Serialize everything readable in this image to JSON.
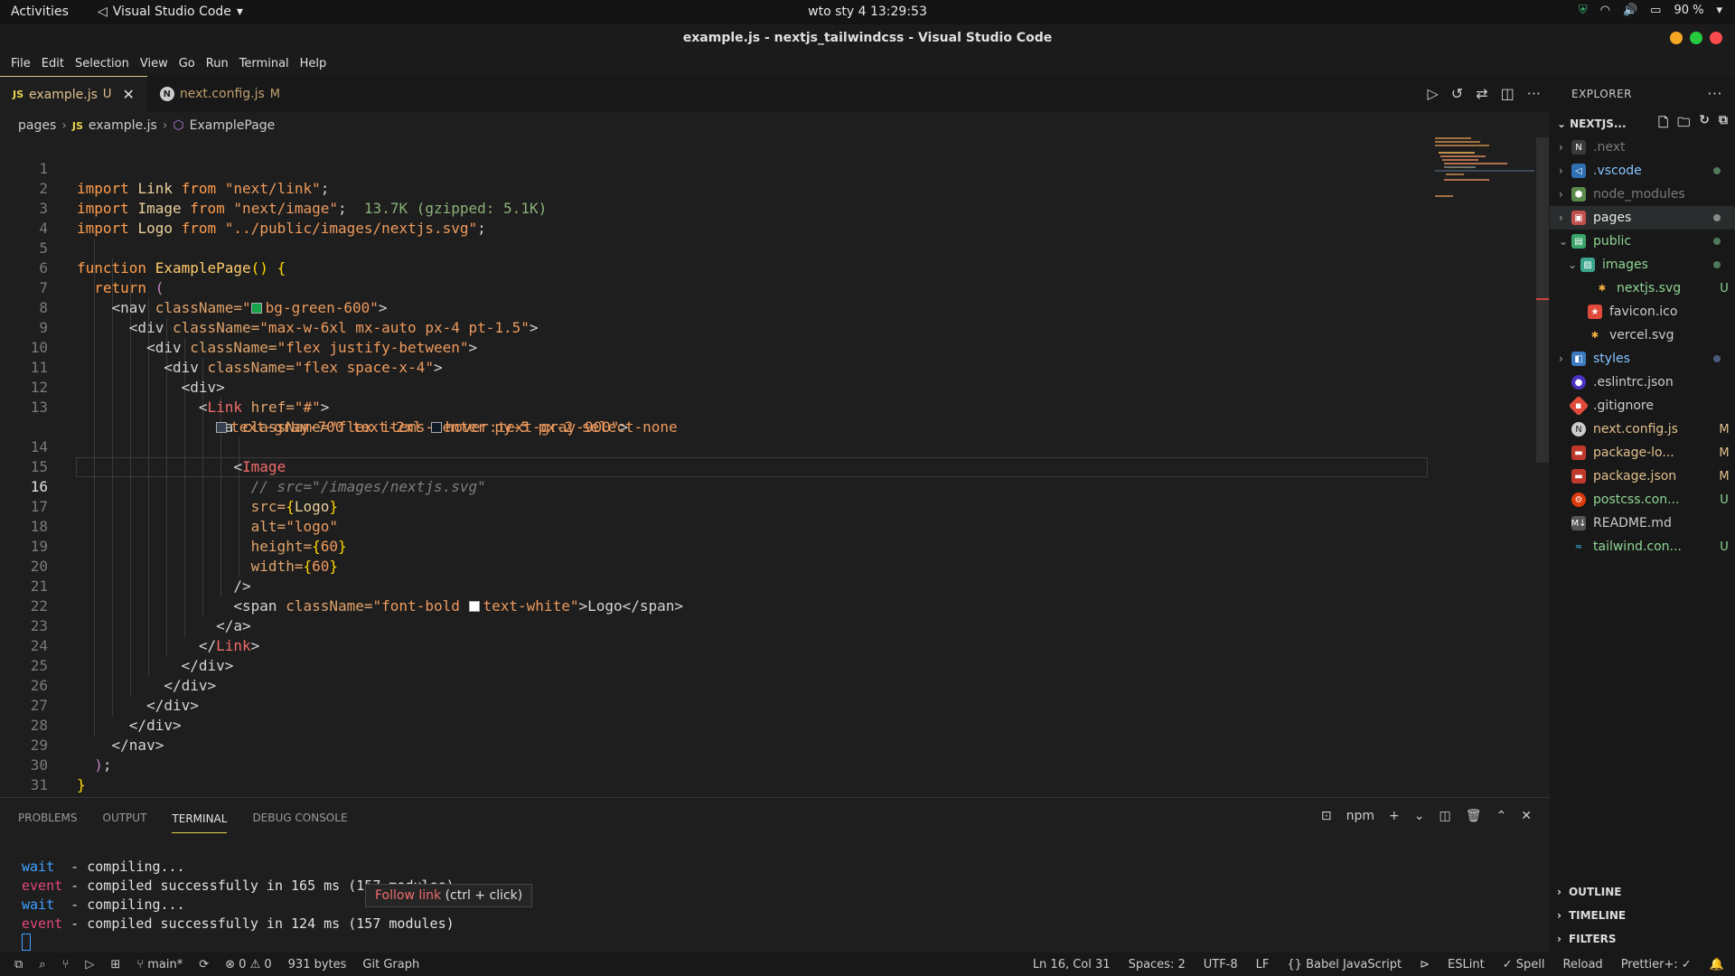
{
  "system": {
    "activities": "Activities",
    "app_name": "Visual Studio Code",
    "clock": "wto sty 4  13:29:53",
    "battery": "90 %"
  },
  "window": {
    "title": "example.js - nextjs_tailwindcss - Visual Studio Code"
  },
  "menu": [
    "File",
    "Edit",
    "Selection",
    "View",
    "Go",
    "Run",
    "Terminal",
    "Help"
  ],
  "tabs": [
    {
      "badge": "JS",
      "label": "example.js",
      "status": "U",
      "close": "✕"
    },
    {
      "badge": "N",
      "label": "next.config.js",
      "status": "M"
    }
  ],
  "breadcrumb": {
    "folder": "pages",
    "file_badge": "JS",
    "file": "example.js",
    "symbol": "ExamplePage"
  },
  "code": {
    "current_line": "16",
    "line_numbers": [
      "1",
      "2",
      "3",
      "4",
      "5",
      "6",
      "7",
      "8",
      "9",
      "10",
      "11",
      "12",
      "13",
      "14",
      "15",
      "16",
      "17",
      "18",
      "19",
      "20",
      "21",
      "22",
      "23",
      "24",
      "25",
      "26",
      "27",
      "28",
      "29",
      "30",
      "31"
    ],
    "l1": [
      "import",
      "Link",
      "from",
      "\"next/link\"",
      ";"
    ],
    "l2": [
      "import",
      "Image",
      "from",
      "\"next/image\"",
      ";",
      "13.7K (gzipped: 5.1K)"
    ],
    "l3": [
      "import",
      "Logo",
      "from",
      "\"../public/images/nextjs.svg\"",
      ";"
    ],
    "l5": [
      "function",
      "ExamplePage",
      "() {"
    ],
    "l6": [
      "return",
      "("
    ],
    "l7": [
      "<nav",
      "className=",
      "\"",
      "bg-green-600\"",
      ">"
    ],
    "l8": [
      "<div",
      "className=",
      "\"max-w-6xl mx-auto px-4 pt-1.5\"",
      ">"
    ],
    "l9": [
      "<div",
      "className=",
      "\"flex justify-between\"",
      ">"
    ],
    "l10": [
      "<div",
      "className=",
      "\"flex space-x-4\"",
      ">"
    ],
    "l11": [
      "<div>"
    ],
    "l12": [
      "<",
      "Link",
      "href=",
      "\"#\"",
      ">"
    ],
    "l13": [
      "<a",
      "className=",
      "\"flex items-center py-5 px-2 select-none"
    ],
    "l13b": [
      "text-gray-700 text-2xl ",
      "hover:text-gray-900\"",
      ">"
    ],
    "l14": [
      "<",
      "Image"
    ],
    "l15": [
      "// src=\"/images/nextjs.svg\""
    ],
    "l16": [
      "src=",
      "{",
      "Logo",
      "}"
    ],
    "l17": [
      "alt=",
      "\"logo\""
    ],
    "l18": [
      "height=",
      "{",
      "60",
      "}"
    ],
    "l19": [
      "width=",
      "{",
      "60",
      "}"
    ],
    "l20": [
      "/>"
    ],
    "l21": [
      "<span",
      "className=",
      "\"font-bold ",
      "text-white\"",
      ">Logo</span>"
    ],
    "l22": [
      "</a>"
    ],
    "l23": [
      "</",
      "Link",
      ">"
    ],
    "l24": [
      "</div>"
    ],
    "l25": [
      "</div>"
    ],
    "l26": [
      "</div>"
    ],
    "l27": [
      "</div>"
    ],
    "l28": [
      "</nav>"
    ],
    "l29": [
      ")",
      ";"
    ],
    "l30": [
      "}"
    ]
  },
  "colors": {
    "swatch_green": "#16a34a",
    "swatch_gray700": "#374151",
    "swatch_gray900": "#111827",
    "swatch_white": "#ffffff"
  },
  "explorer": {
    "title": "EXPLORER",
    "project": "NEXTJS...",
    "items": [
      {
        "label": ".next",
        "status": "",
        "dot": false
      },
      {
        "label": ".vscode",
        "status": "",
        "dot": true
      },
      {
        "label": "node_modules",
        "status": "",
        "dot": false
      },
      {
        "label": "pages",
        "status": "",
        "dot": true
      },
      {
        "label": "public",
        "status": "",
        "dot": true
      },
      {
        "label": "images",
        "status": "",
        "dot": true
      },
      {
        "label": "nextjs.svg",
        "status": "U",
        "dot": false
      },
      {
        "label": "favicon.ico",
        "status": "",
        "dot": false
      },
      {
        "label": "vercel.svg",
        "status": "",
        "dot": false
      },
      {
        "label": "styles",
        "status": "",
        "dot": true
      },
      {
        "label": ".eslintrc.json",
        "status": "",
        "dot": false
      },
      {
        "label": ".gitignore",
        "status": "",
        "dot": false
      },
      {
        "label": "next.config.js",
        "status": "M",
        "dot": false
      },
      {
        "label": "package-lo...",
        "status": "M",
        "dot": false
      },
      {
        "label": "package.json",
        "status": "M",
        "dot": false
      },
      {
        "label": "postcss.con...",
        "status": "U",
        "dot": false
      },
      {
        "label": "README.md",
        "status": "",
        "dot": false
      },
      {
        "label": "tailwind.con...",
        "status": "U",
        "dot": false
      }
    ],
    "sections": [
      "OUTLINE",
      "TIMELINE",
      "FILTERS"
    ]
  },
  "panel": {
    "tabs": [
      "PROBLEMS",
      "OUTPUT",
      "TERMINAL",
      "DEBUG CONSOLE"
    ],
    "shell": "npm",
    "terminal": [
      [
        "wait",
        "  - compiling..."
      ],
      [
        "event",
        " - compiled successfully in 165 ms (157 modules)"
      ],
      [
        "wait",
        "  - compiling..."
      ],
      [
        "event",
        " - compiled successfully in 124 ms (157 modules)"
      ]
    ],
    "tooltip_link": "Follow link",
    "tooltip_hint": " (ctrl + click)"
  },
  "status": {
    "branch": "main*",
    "errors": "0",
    "warnings": "0",
    "size": "931 bytes",
    "git_graph": "Git Graph",
    "position": "Ln 16, Col 31",
    "spaces": "Spaces: 2",
    "encoding": "UTF-8",
    "eol": "LF",
    "language": "Babel JavaScript",
    "eslint": "ESLint",
    "spell": "Spell",
    "reload": "Reload",
    "prettier": "Prettier+: ✓"
  }
}
